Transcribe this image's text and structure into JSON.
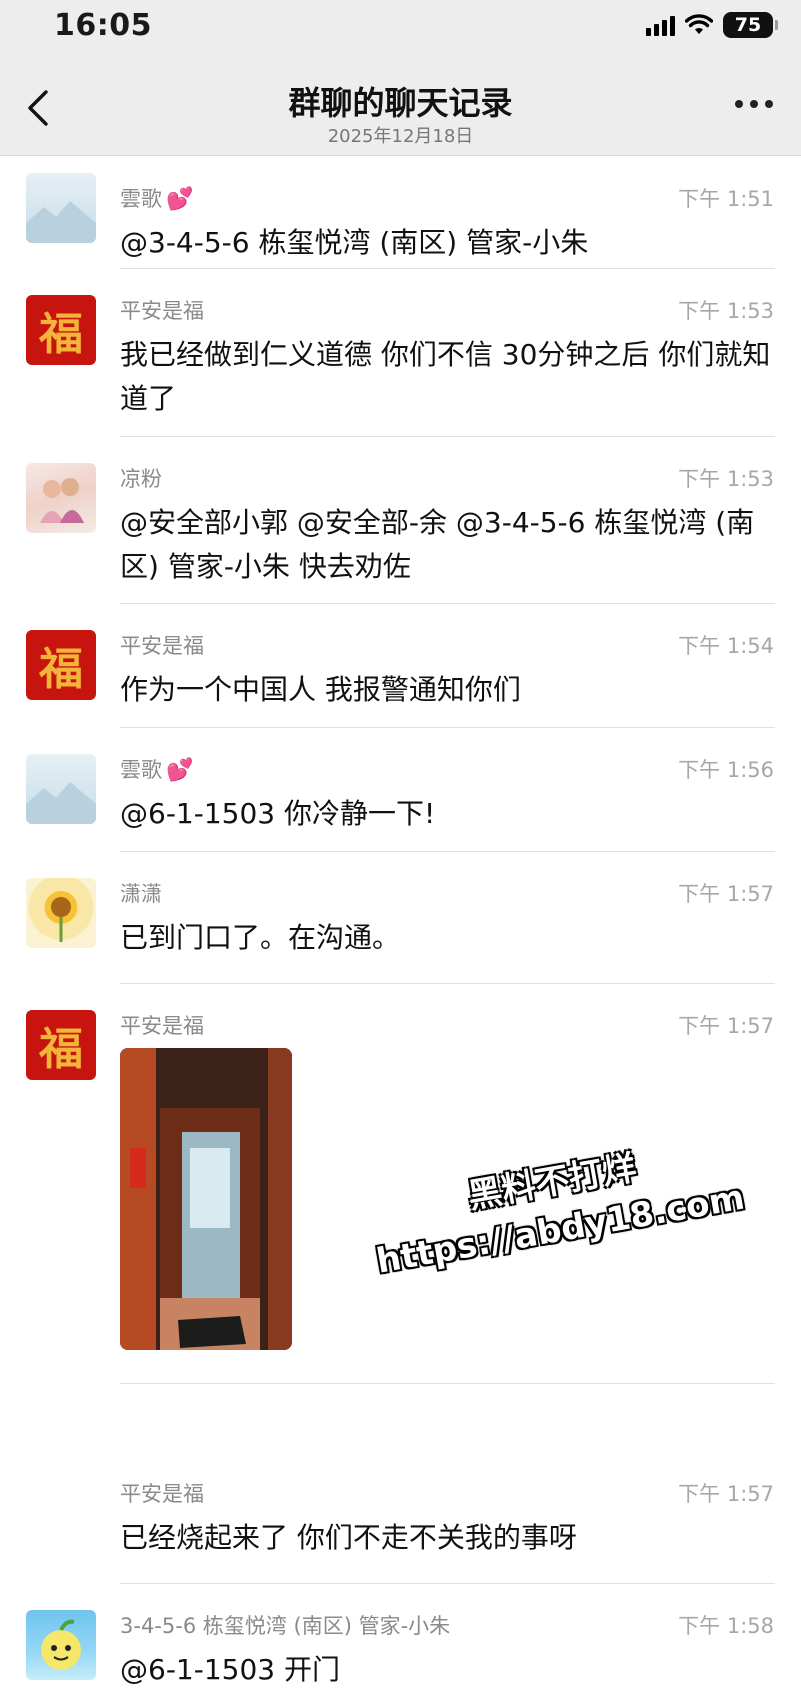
{
  "status": {
    "time": "16:05",
    "battery": "75"
  },
  "nav": {
    "title": "群聊的聊天记录",
    "subtitle": "2025年12月18日"
  },
  "messages": [
    {
      "sender": "雲歌",
      "time": "下午 1:51",
      "text": "@3-4-5-6 栋玺悦湾 (南区) 管家-小朱"
    },
    {
      "sender": "平安是福",
      "time": "下午 1:53",
      "text": "我已经做到仁义道德 你们不信 30分钟之后 你们就知道了"
    },
    {
      "sender": "凉粉",
      "time": "下午 1:53",
      "text": "@安全部小郭 @安全部-余 @3-4-5-6 栋玺悦湾 (南区) 管家-小朱 快去劝佐"
    },
    {
      "sender": "平安是福",
      "time": "下午 1:54",
      "text": "作为一个中国人 我报警通知你们"
    },
    {
      "sender": "雲歌",
      "time": "下午 1:56",
      "text": "@6-1-1503 你冷静一下!"
    },
    {
      "sender": "潇潇",
      "time": "下午 1:57",
      "text": "已到门口了。在沟通。"
    },
    {
      "sender": "平安是福",
      "time": "下午 1:57",
      "text": ""
    },
    {
      "sender": "平安是福",
      "time": "下午 1:57",
      "text": "已经烧起来了 你们不走不关我的事呀"
    },
    {
      "sender": "3-4-5-6 栋玺悦湾 (南区) 管家-小朱",
      "time": "下午 1:58",
      "text": "@6-1-1503 开门"
    }
  ],
  "watermark": {
    "line1": "黑料不打烊",
    "line2": "https://abdy18.com"
  },
  "colors": {
    "header_bg": "#ededed",
    "fu_red": "#c8140f",
    "heart": "#e83d8f"
  }
}
